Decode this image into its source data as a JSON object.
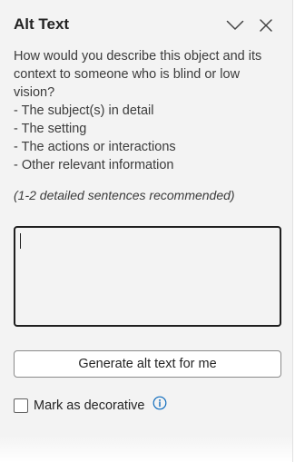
{
  "pane": {
    "title": "Alt Text",
    "collapse_icon": "chevron-down-icon",
    "close_icon": "close-icon"
  },
  "description": {
    "intro": "How would you describe this object and its context to someone who is blind or low vision?",
    "bullets": [
      "- The subject(s) in detail",
      "- The setting",
      "- The actions or interactions",
      "- Other relevant information"
    ],
    "hint": "(1-2 detailed sentences recommended)"
  },
  "alt_text_input": {
    "value": ""
  },
  "generate_button": {
    "label": "Generate alt text for me"
  },
  "decorative": {
    "label": "Mark as decorative",
    "checked": false,
    "info_icon": "info-icon"
  },
  "colors": {
    "pane_background": "#f3f3f3",
    "text": "#242424",
    "accent_info": "#0f6cbd"
  }
}
